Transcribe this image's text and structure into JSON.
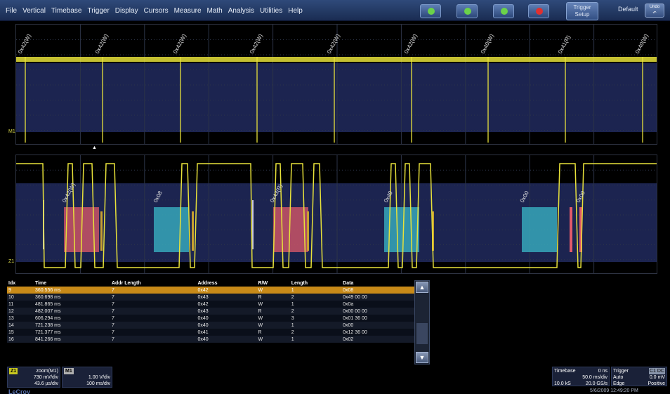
{
  "menu": [
    "File",
    "Vertical",
    "Timebase",
    "Trigger",
    "Display",
    "Cursors",
    "Measure",
    "Math",
    "Analysis",
    "Utilities",
    "Help"
  ],
  "toolbar": {
    "trigger_setup_line1": "Trigger",
    "trigger_setup_line2": "Setup",
    "default_label": "Default",
    "undo_label": "Undo"
  },
  "colors": {
    "trace": "#e8e23a",
    "write_addr": "#e05a6a",
    "data": "#3ab8c8",
    "grid_band": "#1c2450",
    "menubar": "#243a66"
  },
  "top_trace": {
    "label": "M1",
    "decode_labels": [
      "0x42(W)",
      "0x42(W)",
      "0x42(W)",
      "0x42(W)",
      "0x42(W)",
      "0x42(W)",
      "0x40(W)",
      "0x41(R)",
      "0x40(W)"
    ]
  },
  "bottom_trace": {
    "label": "Z1",
    "decode_labels": [
      "0x42(W)",
      "0x08",
      "0x43(R)",
      "0x49",
      "0x00",
      "0x00"
    ]
  },
  "table": {
    "headers": [
      "Idx",
      "Time",
      "Addr Length",
      "Address",
      "R/W",
      "Length",
      "Data"
    ],
    "rows": [
      [
        "9",
        "360.556 ms",
        "7",
        "0x42",
        "W",
        "1",
        "0x08"
      ],
      [
        "10",
        "360.698 ms",
        "7",
        "0x43",
        "R",
        "2",
        "0x49 00 00"
      ],
      [
        "11",
        "481.865 ms",
        "7",
        "0x42",
        "W",
        "1",
        "0x0a"
      ],
      [
        "12",
        "482.007 ms",
        "7",
        "0x43",
        "R",
        "2",
        "0x00 00 00"
      ],
      [
        "13",
        "606.294 ms",
        "7",
        "0x40",
        "W",
        "3",
        "0x01 36 00"
      ],
      [
        "14",
        "721.238 ms",
        "7",
        "0x40",
        "W",
        "1",
        "0x00"
      ],
      [
        "15",
        "721.377 ms",
        "7",
        "0x41",
        "R",
        "2",
        "0x12 36 00"
      ],
      [
        "16",
        "841.266 ms",
        "7",
        "0x40",
        "W",
        "1",
        "0x02"
      ]
    ],
    "selected_index": 0
  },
  "channels": {
    "z1": {
      "tag": "Z1",
      "name": "zoom(M1)",
      "vdiv": "730 mV/div",
      "tdiv": "43.6 µs/div"
    },
    "m1": {
      "tag": "M1",
      "vdiv": "1.00 V/div",
      "tdiv": "100 ms/div"
    }
  },
  "timebase": {
    "title": "Timebase",
    "delay": "0 ns",
    "tdiv": "50.0 ms/div",
    "samples": "10.0 kS",
    "rate": "20.0 GS/s"
  },
  "trigger": {
    "title": "Trigger",
    "tags": "C1 DC",
    "mode": "Auto",
    "level": "0.0 mV",
    "type": "Edge",
    "slope": "Positive"
  },
  "brand": "LeCroy",
  "datetime": "5/6/2009 12:49:20 PM"
}
